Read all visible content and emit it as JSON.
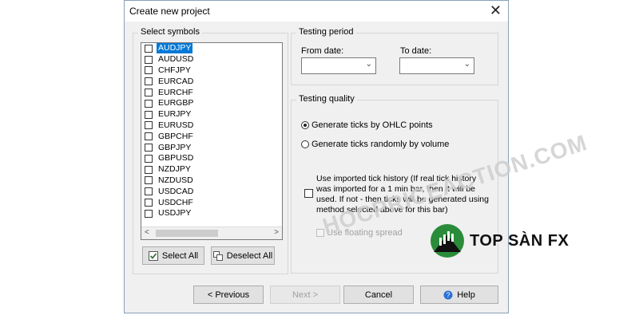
{
  "dialog": {
    "title": "Create new project"
  },
  "symbols": {
    "group_title": "Select symbols",
    "items": [
      "AUDJPY",
      "AUDUSD",
      "CHFJPY",
      "EURCAD",
      "EURCHF",
      "EURGBP",
      "EURJPY",
      "EURUSD",
      "GBPCHF",
      "GBPJPY",
      "GBPUSD",
      "NZDJPY",
      "NZDUSD",
      "USDCAD",
      "USDCHF",
      "USDJPY"
    ],
    "selected": "AUDJPY",
    "select_all_label": "Select All",
    "deselect_all_label": "Deselect All",
    "scroll_left": "<",
    "scroll_right": ">"
  },
  "testing_period": {
    "group_title": "Testing period",
    "from_label": "From date:",
    "to_label": "To date:",
    "from_value": "",
    "to_value": ""
  },
  "testing_quality": {
    "group_title": "Testing quality",
    "option_ohlc": "Generate ticks by OHLC points",
    "option_random": "Generate ticks randomly by volume",
    "selected_option": "ohlc",
    "tick_history_line1": "Use imported tick history (If real tick history",
    "tick_history_line2": "was imported for a 1 min bar, then it will be",
    "tick_history_line3": "used. If not - then ticks will be generated using",
    "tick_history_line4": "method selected above for this bar)",
    "floating_spread": "Use floating spread"
  },
  "footer": {
    "previous": "< Previous",
    "next": "Next >",
    "cancel": "Cancel",
    "help": "Help"
  },
  "overlay": {
    "watermark": "HOCPRICEACTION.COM",
    "brand": "TOP SÀN FX"
  },
  "colors": {
    "selection": "#0078d7",
    "help_icon": "#2b6fd6",
    "logo_green": "#2a8c3a"
  }
}
